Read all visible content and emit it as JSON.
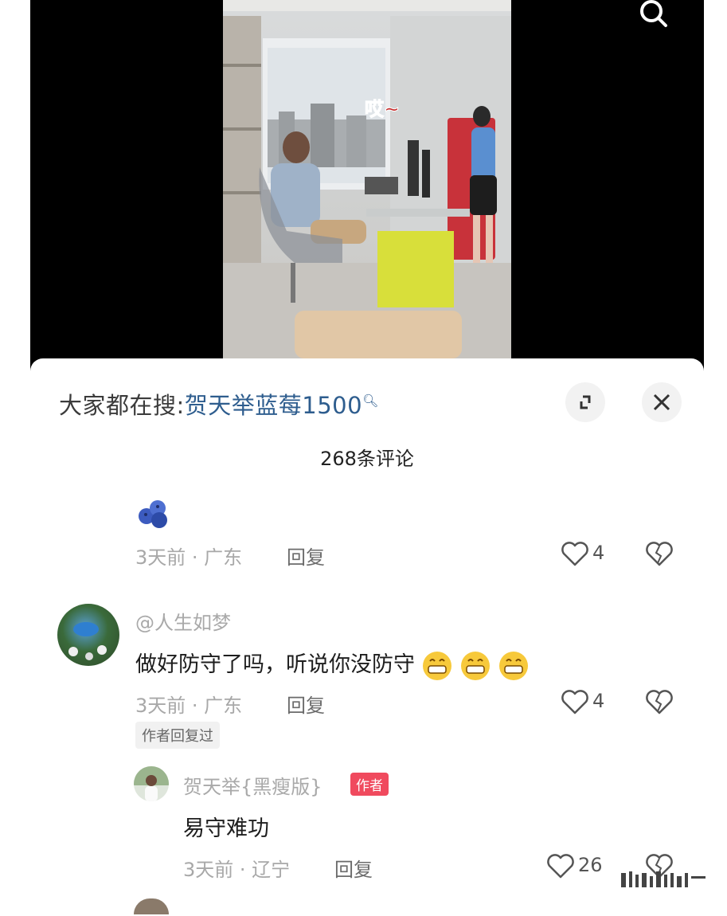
{
  "search_hint": {
    "prefix": "大家都在搜:",
    "keyword": "贺天举蓝莓1500"
  },
  "video": {
    "overlay_text": "哎~"
  },
  "comments_header": {
    "count_label": "268条评论"
  },
  "comments": [
    {
      "content_emoji": "blueberry",
      "meta": "3天前 · 广东",
      "reply_label": "回复",
      "likes": "4"
    },
    {
      "username": "@人生如梦",
      "text": "做好防守了吗，听说你没防守",
      "meta": "3天前 · 广东",
      "reply_label": "回复",
      "likes": "4",
      "author_replied_tag": "作者回复过",
      "reply": {
        "username": "贺天举{黑瘦版}",
        "author_badge": "作者",
        "text": "易守难功",
        "meta": "3天前 · 辽宁",
        "reply_label": "回复",
        "likes": "26"
      }
    }
  ],
  "colors": {
    "keyword": "#2e5d8e",
    "author_badge": "#f04a5e",
    "meta": "#a8a8a8"
  }
}
